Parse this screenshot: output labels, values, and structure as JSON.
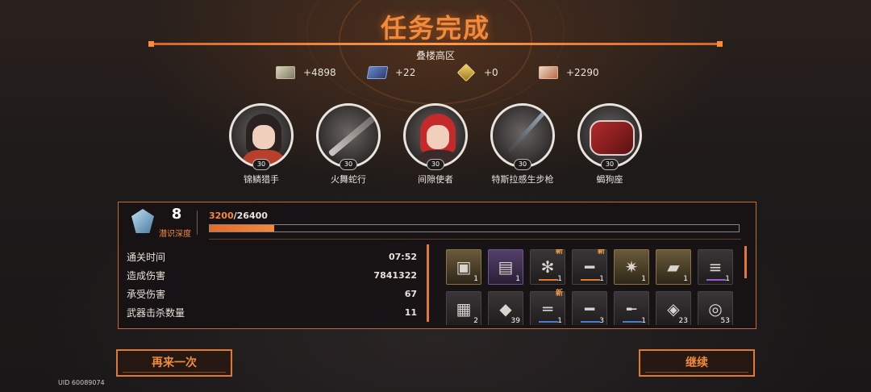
{
  "title": "任务完成",
  "subtitle": "叠楼高区",
  "rewards": [
    {
      "icon": "cash-icon",
      "value": "+4898"
    },
    {
      "icon": "box-icon",
      "value": "+22"
    },
    {
      "icon": "gem-icon",
      "value": "+0"
    },
    {
      "icon": "ticket-icon",
      "value": "+2290"
    }
  ],
  "characters": [
    {
      "name": "锦鳞猎手",
      "level": "30"
    },
    {
      "name": "火舞蛇行",
      "level": "30"
    },
    {
      "name": "间隙使者",
      "level": "30"
    },
    {
      "name": "特斯拉感生步枪",
      "level": "30"
    },
    {
      "name": "蝎狗座",
      "level": "30"
    }
  ],
  "depth": {
    "value": "8",
    "label": "潜识深度"
  },
  "progress": {
    "current": "3200",
    "separator": "/",
    "total": "26400",
    "fraction": 0.1212
  },
  "stats": [
    {
      "label": "通关时间",
      "value": "07:52"
    },
    {
      "label": "造成伤害",
      "value": "7841322"
    },
    {
      "label": "承受伤害",
      "value": "67"
    },
    {
      "label": "武器击杀数量",
      "value": "11"
    }
  ],
  "items": [
    {
      "icon": "loot-crate-icon",
      "count": "1",
      "new": "",
      "frame": "gold",
      "tier": ""
    },
    {
      "icon": "purple-crate-icon",
      "count": "1",
      "new": "",
      "frame": "gold",
      "tier": ""
    },
    {
      "icon": "spider-chip-icon",
      "count": "1",
      "new": "新",
      "frame": "dark",
      "tier": "orange"
    },
    {
      "icon": "rifle-icon",
      "count": "1",
      "new": "新",
      "frame": "dark",
      "tier": "orange"
    },
    {
      "icon": "star-core-icon",
      "count": "1",
      "new": "",
      "frame": "gold",
      "tier": ""
    },
    {
      "icon": "gold-card-icon",
      "count": "1",
      "new": "",
      "frame": "gold",
      "tier": ""
    },
    {
      "icon": "mod-chip-icon",
      "count": "1",
      "new": "",
      "frame": "dark",
      "tier": "violet"
    },
    {
      "icon": "red-case-icon",
      "count": "2",
      "new": "",
      "frame": "dark",
      "tier": ""
    },
    {
      "icon": "crystal-icon",
      "count": "39",
      "new": "",
      "frame": "dark",
      "tier": ""
    },
    {
      "icon": "smg-icon",
      "count": "1",
      "new": "新",
      "frame": "dark",
      "tier": "blue"
    },
    {
      "icon": "shotgun-icon",
      "count": "3",
      "new": "",
      "frame": "dark",
      "tier": "blue"
    },
    {
      "icon": "pistol-icon",
      "count": "1",
      "new": "",
      "frame": "dark",
      "tier": "blue"
    },
    {
      "icon": "ore-icon",
      "count": "23",
      "new": "",
      "frame": "dark",
      "tier": ""
    },
    {
      "icon": "ring-icon",
      "count": "53",
      "new": "",
      "frame": "dark",
      "tier": ""
    }
  ],
  "buttons": {
    "retry": "再来一次",
    "continue": "继续"
  },
  "uid": "UID 60089074"
}
